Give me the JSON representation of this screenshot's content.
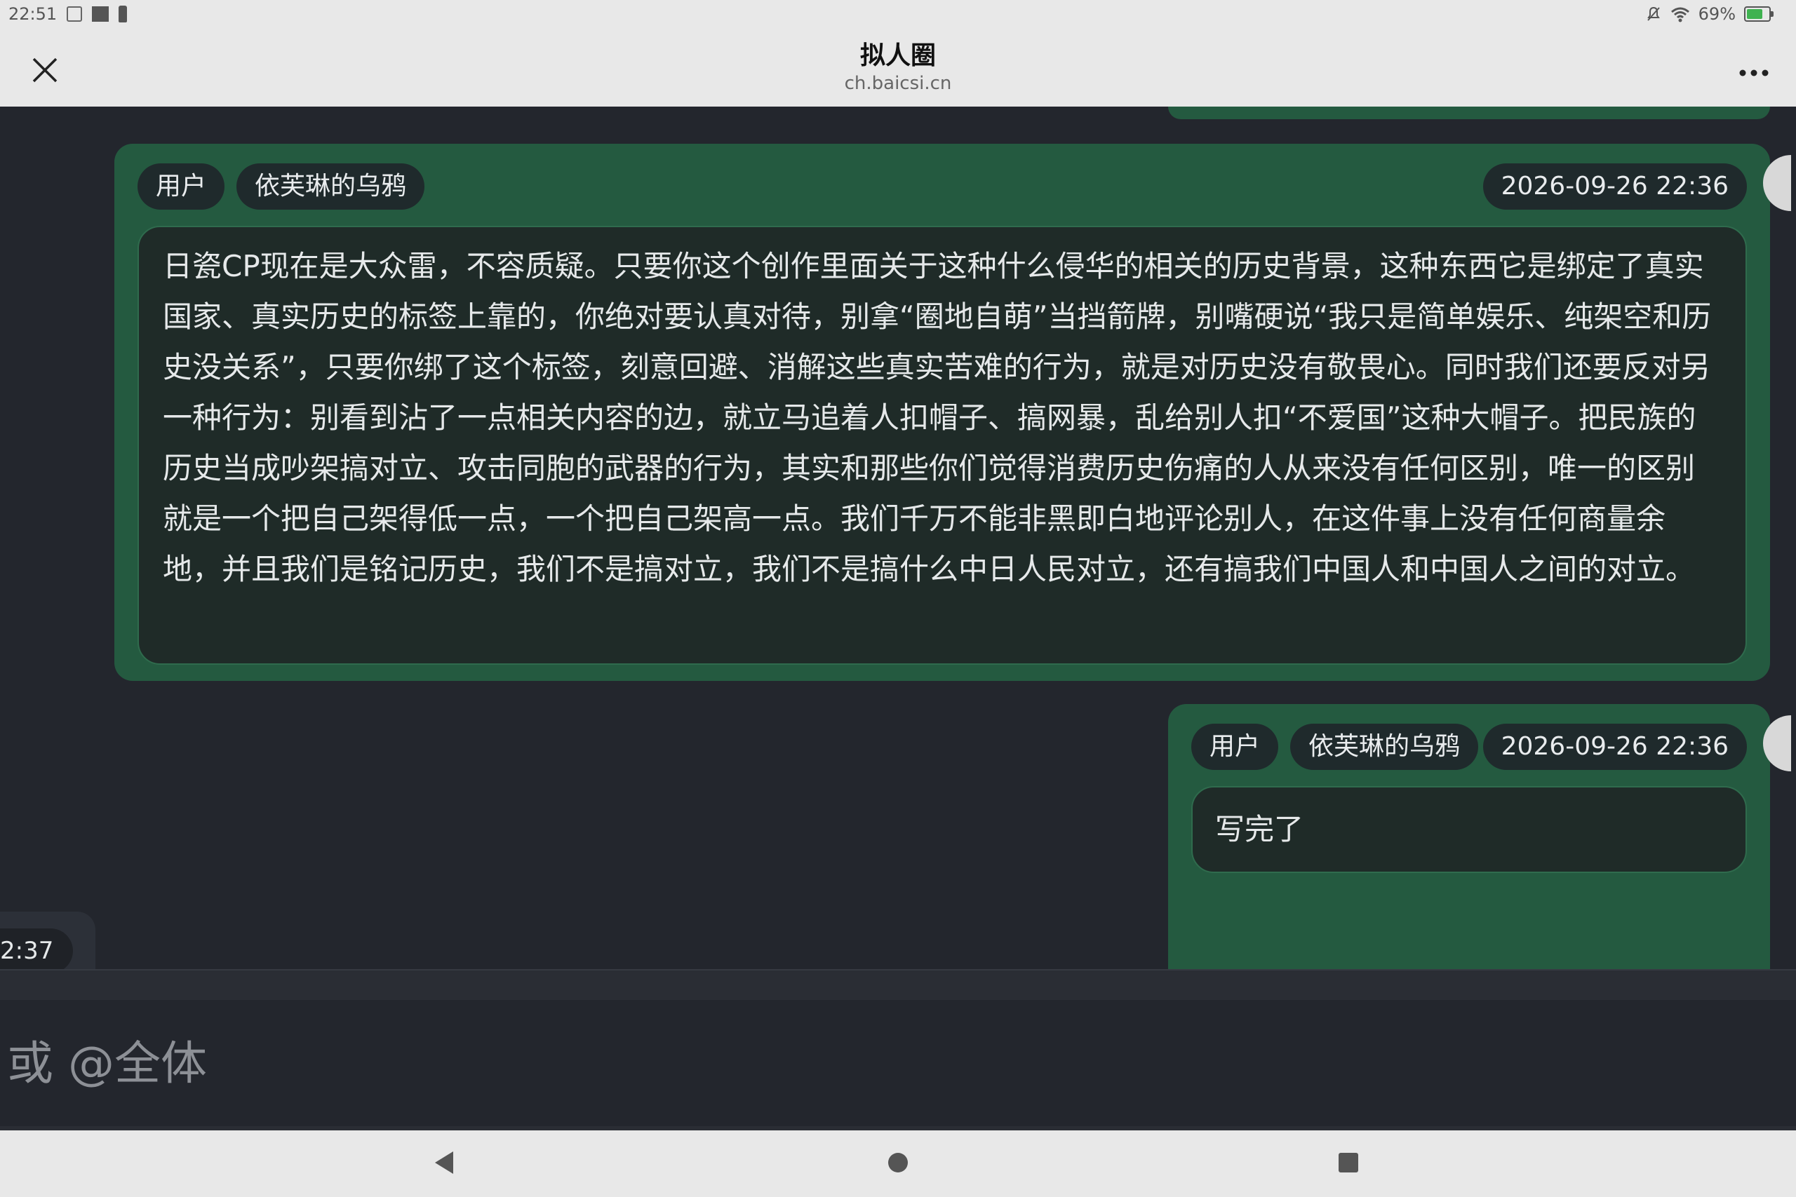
{
  "status_bar": {
    "time": "22:51",
    "battery": "69%",
    "icons": [
      "calendar-icon",
      "square-icon",
      "sd-card-icon",
      "mute-icon",
      "wifi-icon",
      "battery-icon"
    ]
  },
  "header": {
    "title": "拟人圈",
    "subtitle": "ch.baicsi.cn",
    "close_icon": "×",
    "more_icon": "•••"
  },
  "messages": [
    {
      "role": "用户",
      "username": "依芙琳的乌鸦",
      "timestamp": "2026-09-26 22:36",
      "text": "日瓷CP现在是大众雷，不容质疑。只要你这个创作里面关于这种什么侵华的相关的历史背景，这种东西它是绑定了真实国家、真实历史的标签上靠的，你绝对要认真对待，别拿“圈地自萌”当挡箭牌，别嘴硬说“我只是简单娱乐、纯架空和历史没关系”，只要你绑了这个标签，刻意回避、消解这些真实苦难的行为，就是对历史没有敬畏心。同时我们还要反对另一种行为：别看到沾了一点相关内容的边，就立马追着人扣帽子、搞网暴，乱给别人扣“不爱国”这种大帽子。把民族的历史当成吵架搞对立、攻击同胞的武器的行为，其实和那些你们觉得消费历史伤痛的人从来没有任何区别，唯一的区别就是一个把自己架得低一点，一个把自己架高一点。我们千万不能非黑即白地评论别人，在这件事上没有任何商量余地，并且我们是铭记历史，我们不是搞对立，我们不是搞什么中日人民对立，还有搞我们中国人和中国人之间的对立。"
    },
    {
      "role": "用户",
      "username": "依芙琳的乌鸦",
      "timestamp": "2026-09-26 22:36",
      "text": "写完了"
    }
  ],
  "partial_message": {
    "timestamp_fragment": "2:37"
  },
  "input": {
    "placeholder": "或 @全体",
    "value": ""
  },
  "nav": {
    "back_icon": "back-triangle-icon",
    "home_icon": "home-circle-icon",
    "recent_icon": "recent-square-icon"
  },
  "colors": {
    "bubble_green": "#245a40",
    "background": "#23262d",
    "bar": "#e8e8e8"
  }
}
